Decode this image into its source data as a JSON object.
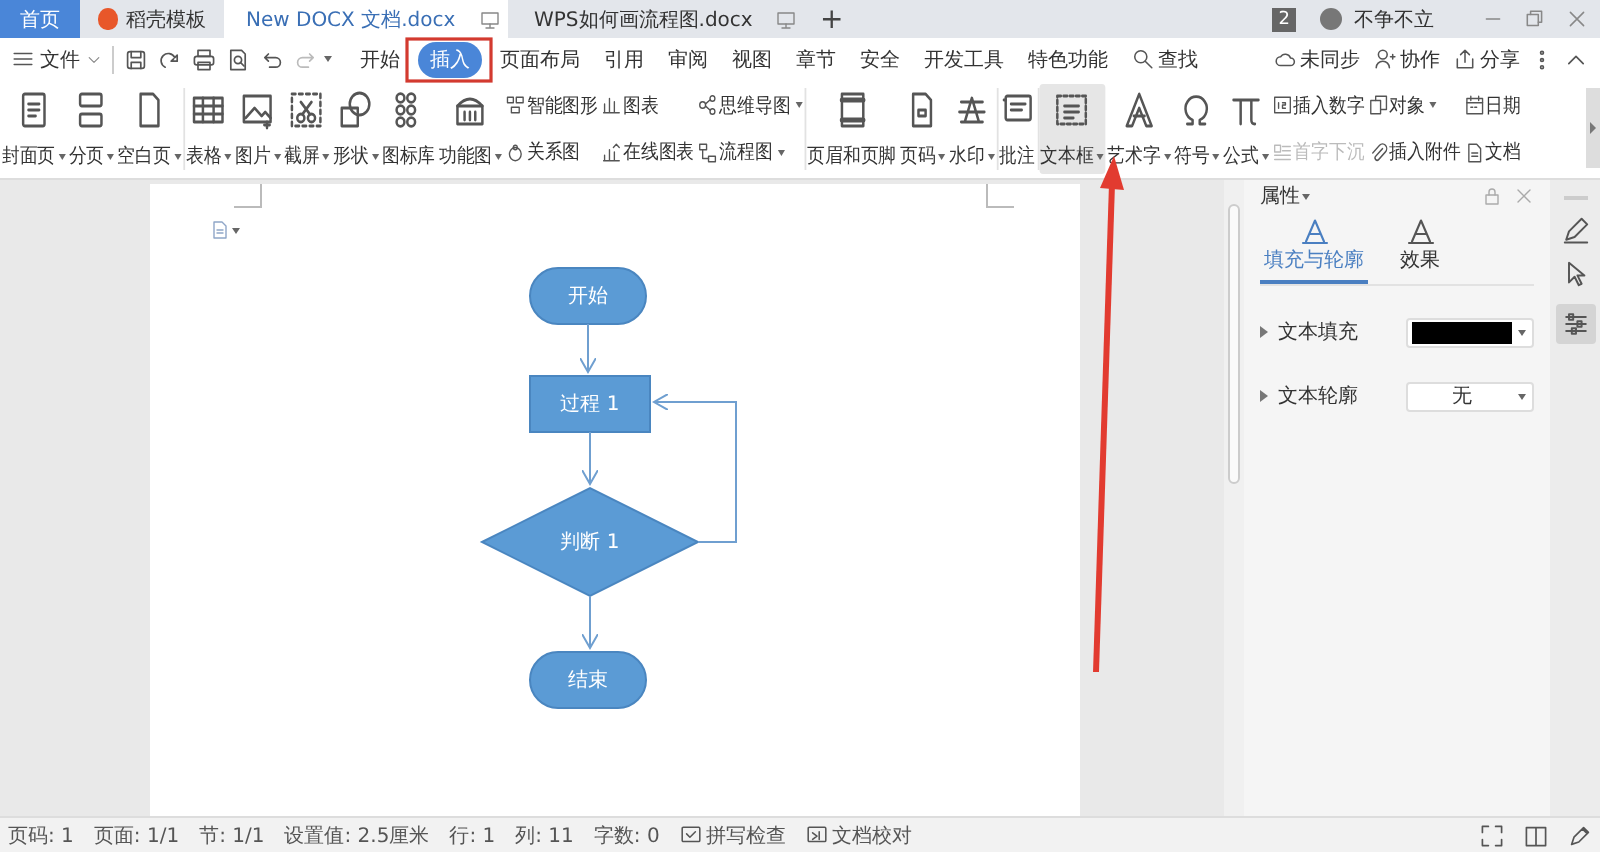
{
  "tabs": [
    {
      "label": "首页",
      "kind": "home",
      "selected": false
    },
    {
      "label": "稻壳模板",
      "kind": "template",
      "selected": false
    },
    {
      "label": "New DOCX 文档.docx",
      "kind": "doc",
      "selected": true
    },
    {
      "label": "WPS如何画流程图.docx",
      "kind": "doc",
      "selected": false
    }
  ],
  "new_tab": "+",
  "notification_count": "2",
  "user": "不争不立",
  "file_menu": "文件",
  "menu_tabs": [
    {
      "label": "开始",
      "selected": false
    },
    {
      "label": "插入",
      "selected": true
    },
    {
      "label": "页面布局",
      "selected": false
    },
    {
      "label": "引用",
      "selected": false
    },
    {
      "label": "审阅",
      "selected": false
    },
    {
      "label": "视图",
      "selected": false
    },
    {
      "label": "章节",
      "selected": false
    },
    {
      "label": "安全",
      "selected": false
    },
    {
      "label": "开发工具",
      "selected": false
    },
    {
      "label": "特色功能",
      "selected": false
    }
  ],
  "search": "查找",
  "sync": "未同步",
  "collaborate": "协作",
  "share": "分享",
  "ribbon": [
    [
      {
        "kind": "large",
        "label": "封面页",
        "dropdown": true
      },
      {
        "kind": "large",
        "label": "分页",
        "dropdown": true
      },
      {
        "kind": "large",
        "label": "空白页",
        "dropdown": true
      }
    ],
    [
      {
        "kind": "large",
        "label": "表格",
        "dropdown": true
      },
      {
        "kind": "large",
        "label": "图片",
        "dropdown": true
      },
      {
        "kind": "large",
        "label": "截屏",
        "dropdown": true
      },
      {
        "kind": "large",
        "label": "形状",
        "dropdown": true
      },
      {
        "kind": "large",
        "label": "图标库",
        "dropdown": false
      },
      {
        "kind": "large",
        "label": "功能图",
        "dropdown": true
      },
      {
        "kind": "stack",
        "items": [
          {
            "label": "智能图形",
            "dropdown": false,
            "disabled": false
          },
          {
            "label": "关系图",
            "dropdown": false,
            "disabled": false
          }
        ]
      },
      {
        "kind": "stack",
        "items": [
          {
            "label": "图表",
            "dropdown": false,
            "disabled": false
          },
          {
            "label": "在线图表",
            "dropdown": false,
            "disabled": false
          }
        ]
      },
      {
        "kind": "stack",
        "items": [
          {
            "label": "思维导图",
            "dropdown": true,
            "disabled": false
          },
          {
            "label": "流程图",
            "dropdown": true,
            "disabled": false
          }
        ]
      }
    ],
    [
      {
        "kind": "large",
        "label": "页眉和页脚",
        "dropdown": false
      },
      {
        "kind": "large",
        "label": "页码",
        "dropdown": true
      },
      {
        "kind": "large",
        "label": "水印",
        "dropdown": true
      }
    ],
    [
      {
        "kind": "large",
        "label": "批注",
        "dropdown": false
      }
    ],
    [
      {
        "kind": "large",
        "label": "文本框",
        "dropdown": true,
        "highlighted": true
      },
      {
        "kind": "large",
        "label": "艺术字",
        "dropdown": true
      },
      {
        "kind": "large",
        "label": "符号",
        "dropdown": true
      },
      {
        "kind": "large",
        "label": "公式",
        "dropdown": true
      },
      {
        "kind": "stack",
        "items": [
          {
            "label": "插入数字",
            "dropdown": false,
            "disabled": false
          },
          {
            "label": "首字下沉",
            "dropdown": false,
            "disabled": true
          }
        ]
      },
      {
        "kind": "stack",
        "items": [
          {
            "label": "对象",
            "dropdown": true,
            "disabled": false
          },
          {
            "label": "插入附件",
            "dropdown": false,
            "disabled": false
          }
        ]
      },
      {
        "kind": "stack",
        "items": [
          {
            "label": "日期",
            "dropdown": false,
            "disabled": false
          },
          {
            "label": "文档",
            "dropdown": false,
            "disabled": false
          }
        ]
      }
    ]
  ],
  "flowchart": {
    "nodes": [
      {
        "kind": "terminal",
        "label": "开始"
      },
      {
        "kind": "process",
        "label": "过程 1"
      },
      {
        "kind": "decision",
        "label": "判断 1"
      },
      {
        "kind": "terminal",
        "label": "结束"
      }
    ]
  },
  "properties": {
    "title": "属性",
    "tabs": [
      {
        "label": "填充与轮廓",
        "selected": true
      },
      {
        "label": "效果",
        "selected": false
      }
    ],
    "rows": [
      {
        "label": "文本填充",
        "kind": "color",
        "color": "#000000"
      },
      {
        "label": "文本轮廓",
        "kind": "select",
        "value": "无"
      }
    ]
  },
  "status_bar": [
    {
      "kind": "text",
      "label": "页码: 1"
    },
    {
      "kind": "text",
      "label": "页面: 1/1"
    },
    {
      "kind": "text",
      "label": "节: 1/1"
    },
    {
      "kind": "text",
      "label": "设置值: 2.5厘米"
    },
    {
      "kind": "text",
      "label": "行: 1"
    },
    {
      "kind": "text",
      "label": "列: 11"
    },
    {
      "kind": "text",
      "label": "字数: 0"
    },
    {
      "kind": "button",
      "label": "拼写检查"
    },
    {
      "kind": "button",
      "label": "文档校对"
    }
  ]
}
